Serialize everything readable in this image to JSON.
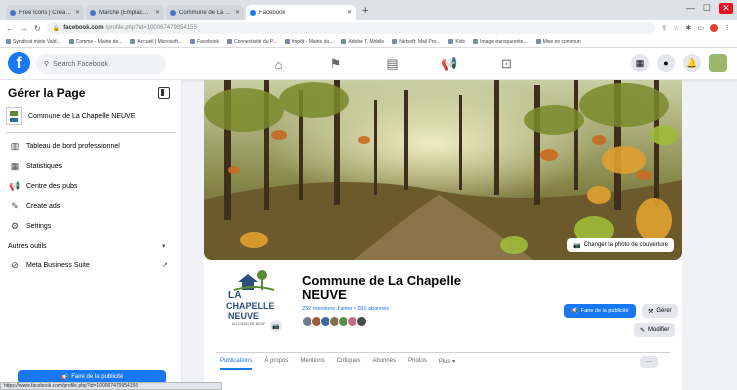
{
  "browser": {
    "tabs": [
      {
        "label": "Free Icons | Create, upgrade an..."
      },
      {
        "label": "Marché (Emplacement Facebook)..."
      },
      {
        "label": "Commune de La Chapelle Neuf..."
      },
      {
        "label": "Facebook",
        "active": true
      }
    ],
    "url_host": "facebook.com",
    "url_path": "/profile.php?id=100067479954155",
    "bookmarks": [
      "Syndicat mixte Vald...",
      "Comme - Mairie de...",
      "Accueil | Microsoft...",
      "Facebook",
      "Connectivité du P...",
      "Impôt - Mairie du...",
      "Adobe T. Mobile",
      "Netsoft: Mail Pro...",
      "Kids",
      "Image transparente...",
      "Mise en commun"
    ]
  },
  "fb": {
    "search_placeholder": "Search Facebook",
    "brand_color": "#1877f2"
  },
  "sidebar": {
    "title": "Gérer la Page",
    "page_name": "Commune de La Chapelle NEUVE",
    "items": [
      {
        "label": "Tableau de bord professionnel",
        "icon": "dashboard-icon"
      },
      {
        "label": "Statistiques",
        "icon": "chart-icon"
      },
      {
        "label": "Centre des pubs",
        "icon": "megaphone-icon"
      },
      {
        "label": "Create ads",
        "icon": "edit-icon"
      },
      {
        "label": "Settings",
        "icon": "gear-icon"
      }
    ],
    "section": "Autres outils",
    "tool": "Meta Business Suite",
    "promote": "Faire de la publicité"
  },
  "page": {
    "change_cover": "Changer la photo de couverture",
    "name": "Commune de La Chapelle NEUVE",
    "stats": "232 mentions J'aime • 281 abonnés",
    "logo_line1": "LA",
    "logo_line2": "CHAPELLE",
    "logo_line3": "NEUVE",
    "logo_tagline": "AU CŒUR DE NEUF",
    "promote": "Faire de la publicité",
    "manage": "Gérer",
    "edit": "Modifier",
    "tabs": [
      "Publications",
      "À propos",
      "Mentions",
      "Critiques",
      "Abonnés",
      "Photos",
      "Plus ▾"
    ],
    "more": "···"
  },
  "status_url": "https://www.facebook.com/profile.php?id=100067479954155"
}
